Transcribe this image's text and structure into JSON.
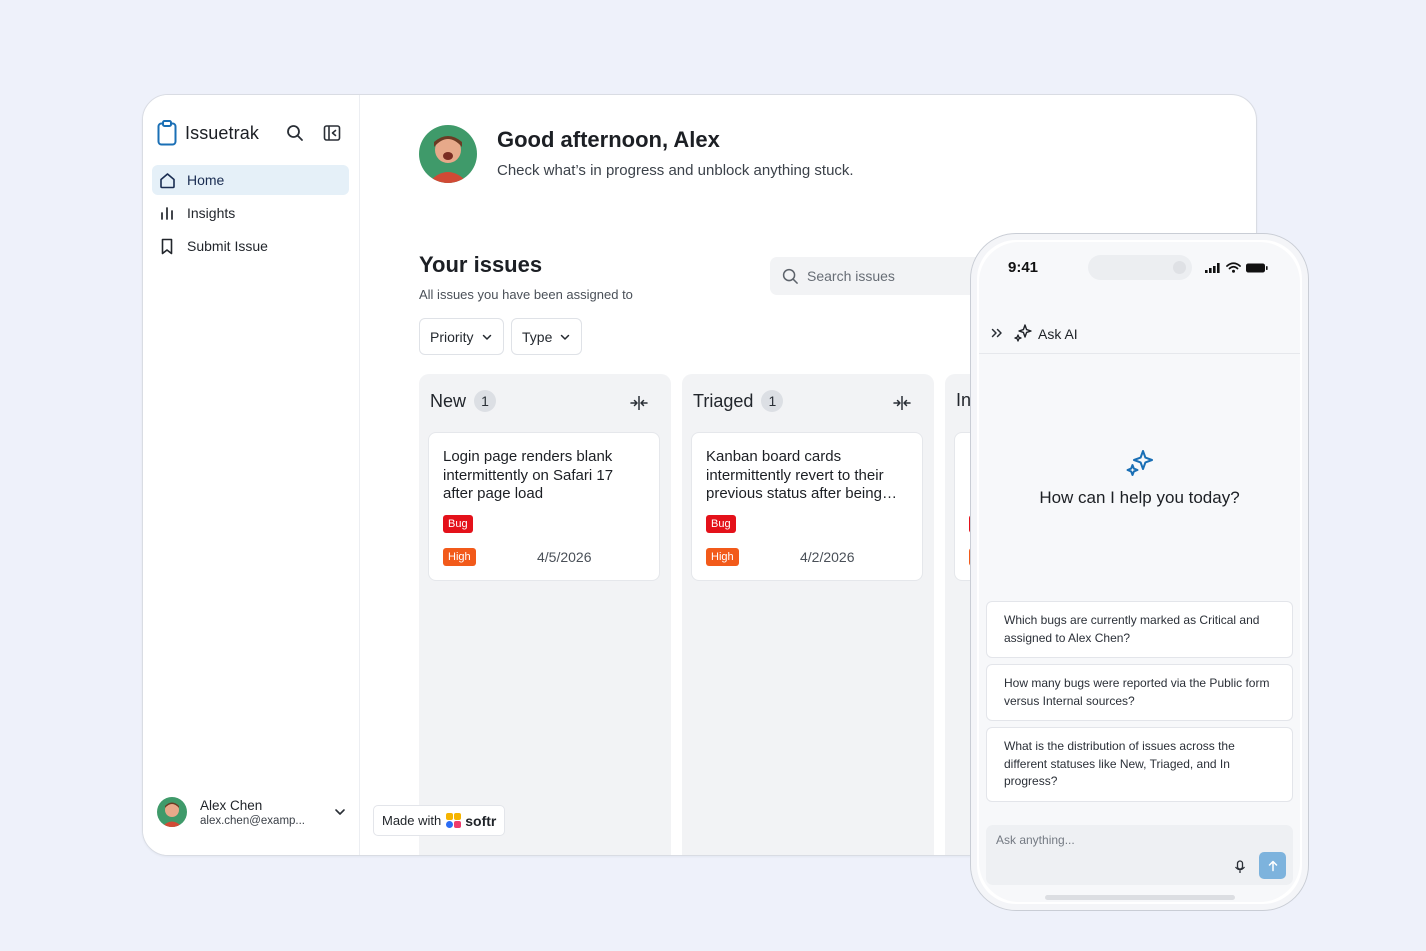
{
  "app": {
    "name": "Issuetrak",
    "accent": "#1a6fb5"
  },
  "sidebar": {
    "items": [
      {
        "label": "Home",
        "icon": "home-icon",
        "active": true
      },
      {
        "label": "Insights",
        "icon": "bar-chart-icon",
        "active": false
      },
      {
        "label": "Submit Issue",
        "icon": "bookmark-icon",
        "active": false
      }
    ],
    "user": {
      "name": "Alex Chen",
      "email": "alex.chen@examp..."
    }
  },
  "header": {
    "greeting": "Good afternoon, Alex",
    "subtitle": "Check what’s in progress and unblock anything stuck."
  },
  "issues": {
    "title": "Your issues",
    "subtitle": "All issues you have been assigned to",
    "search_placeholder": "Search issues",
    "filters": [
      "Priority",
      "Type"
    ],
    "columns": [
      {
        "title": "New",
        "count": "1",
        "card": {
          "title": "Login page renders blank intermittently on Safari 17 after page load",
          "type": "Bug",
          "priority": "High",
          "date": "4/5/2026"
        }
      },
      {
        "title": "Triaged",
        "count": "1",
        "card": {
          "title": "Kanban board cards intermittently revert to their previous status after being moved",
          "type": "Bug",
          "priority": "High",
          "date": "4/2/2026"
        }
      },
      {
        "title": "In",
        "count": ""
      }
    ]
  },
  "footer": {
    "made_with": "Made with",
    "brand": "softr"
  },
  "phone": {
    "time": "9:41",
    "ai_title": "Ask AI",
    "prompt": "How can I help you today?",
    "suggestions": [
      "Which bugs are currently marked as Critical and assigned to Alex Chen?",
      "How many bugs were reported via the Public form versus Internal sources?",
      "What is the distribution of issues across the different statuses like New, Triaged, and In progress?"
    ],
    "input_placeholder": "Ask anything..."
  },
  "colors": {
    "bug": "#e4111a",
    "high": "#f25a1a",
    "active_nav": "#e5f0f8",
    "send_button": "#7db3dd"
  }
}
